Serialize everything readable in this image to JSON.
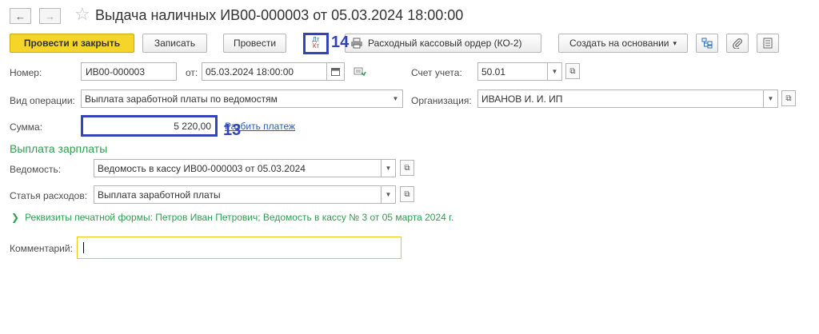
{
  "nav": {
    "back_glyph": "←",
    "forward_glyph": "→",
    "star_glyph": "☆"
  },
  "title": "Выдача наличных ИВ00-000003 от 05.03.2024 18:00:00",
  "toolbar": {
    "post_close": "Провести и закрыть",
    "save": "Записать",
    "post": "Провести",
    "dt_kt_top": "Дт",
    "dt_kt_bottom": "Кт",
    "print_order": "Расходный кассовый ордер (КО-2)",
    "create_based": "Создать на основании",
    "create_based_arrow": "▾"
  },
  "form": {
    "number_label": "Номер:",
    "number_value": "ИВ00-000003",
    "from_label": "от:",
    "date_value": "05.03.2024 18:00:00",
    "account_label": "Счет учета:",
    "account_value": "50.01",
    "op_type_label": "Вид операции:",
    "op_type_value": "Выплата заработной платы по ведомостям",
    "org_label": "Организация:",
    "org_value": "ИВАНОВ И. И. ИП",
    "sum_label": "Сумма:",
    "sum_value": "5 220,00",
    "split_link": "Разбить платеж",
    "section_title": "Выплата зарплаты",
    "statement_label": "Ведомость:",
    "statement_value": "Ведомость в кассу ИВ00-000003 от 05.03.2024",
    "expense_label": "Статья расходов:",
    "expense_value": "Выплата заработной платы",
    "print_details": "Реквизиты печатной формы: Петров Иван Петрович; Ведомость в кассу № 3 от 05 марта 2024 г.",
    "comment_label": "Комментарий:",
    "comment_value": ""
  },
  "annotations": {
    "a14": "14",
    "a13": "13"
  },
  "colors": {
    "primary": "#f6d52b",
    "annotation": "#3344bb",
    "green_text": "#2e9e4e",
    "focus_border": "#f0c419"
  }
}
